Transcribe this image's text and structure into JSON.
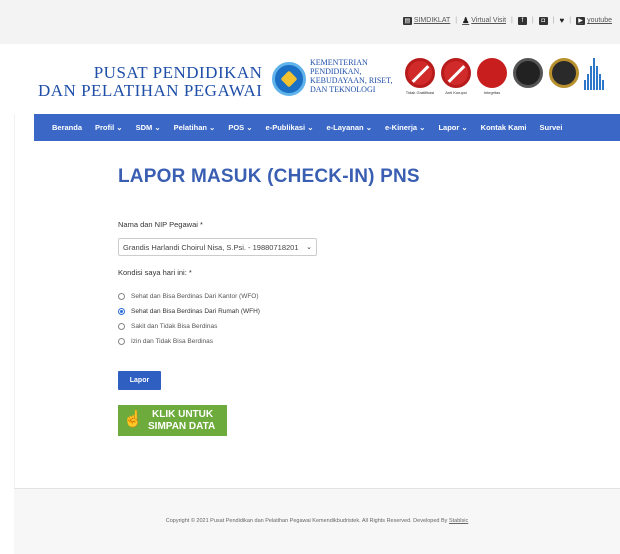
{
  "topbar": {
    "links": [
      {
        "icon": "document-icon",
        "label": "SIMDIKLAT"
      },
      {
        "icon": "walking-person-icon",
        "label": "Virtual Visit"
      },
      {
        "icon": "facebook-icon",
        "label": ""
      },
      {
        "icon": "instagram-icon",
        "label": ""
      },
      {
        "icon": "twitter-icon",
        "label": ""
      },
      {
        "icon": "youtube-icon",
        "label": "youtube"
      }
    ]
  },
  "header": {
    "org_line1": "PUSAT PENDIDIKAN",
    "org_line2": "DAN PELATIHAN PEGAWAI",
    "ministry_lines": [
      "KEMENTERIAN",
      "PENDIDIKAN,",
      "KEBUDAYAAN, RISET,",
      "DAN TEKNOLOGI"
    ],
    "badges": [
      "Tidak Gratifikasi",
      "Anti Korupsi",
      "Integritas",
      "",
      ""
    ]
  },
  "nav": {
    "items": [
      "Beranda",
      "Profil ⌄",
      "SDM ⌄",
      "Pelatihan ⌄",
      "POS ⌄",
      "e-Publikasi ⌄",
      "e-Layanan ⌄",
      "e-Kinerja ⌄",
      "Lapor ⌄",
      "Kontak Kami",
      "Survei"
    ]
  },
  "form": {
    "title": "LAPOR MASUK (CHECK-IN) PNS",
    "name_label": "Nama dan NIP Pegawai *",
    "name_value": "Grandis Harlandi Choirul Nisa, S.Psi. - 19880718201",
    "condition_label": "Kondisi saya hari ini: *",
    "options": [
      "Sehat dan Bisa Berdinas Dari Kantor (WFO)",
      "Sehat dan Bisa Berdinas Dari Rumah (WFH)",
      "Sakit dan Tidak Bisa Berdinas",
      "Izin dan Tidak Bisa Berdinas"
    ],
    "selected_index": 1,
    "submit_label": "Lapor",
    "save_line1": "KLIK UNTUK",
    "save_line2": "SIMPAN DATA"
  },
  "footer": {
    "copyright": "Copyright © 2021 Pusat Pendidikan dan Pelatihan Pegawai Kemendikbudristek. All Rights Reserved. Developed By",
    "developer": "Stablsic"
  },
  "colors": {
    "nav": "#3b68c7",
    "title": "#3a5fb2",
    "button": "#2f5fc0",
    "save_button": "#6dab3d"
  }
}
